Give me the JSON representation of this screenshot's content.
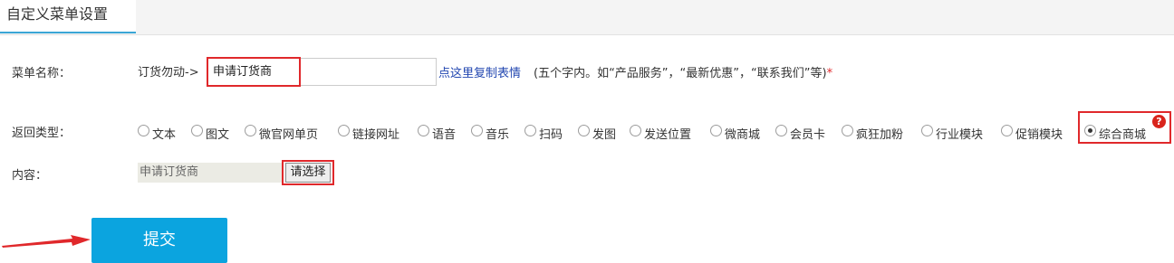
{
  "header": {
    "tab_label": "自定义菜单设置"
  },
  "form": {
    "menu_name_label": "菜单名称：",
    "prefix": "订货勿动->",
    "menu_name_value": "申请订货商",
    "copy_link": "点这里复制表情",
    "hint": "(五个字内。如“产品服务”，“最新优惠”，“联系我们”等)",
    "required_mark": "*",
    "return_type_label": "返回类型：",
    "return_types": [
      "文本",
      "图文",
      "微官网单页",
      "链接网址",
      "语音",
      "音乐",
      "扫码",
      "发图",
      "发送位置",
      "微商城",
      "会员卡",
      "疯狂加粉",
      "行业模块",
      "促销模块",
      "综合商城"
    ],
    "selected_return_type": "综合商城",
    "help_icon": "?",
    "content_label": "内容：",
    "content_value": "申请订货商",
    "choose_button": "请选择",
    "submit_button": "提交"
  },
  "colors": {
    "accent": "#0ba4df",
    "highlight": "#e0282b",
    "link": "#2146b0"
  }
}
